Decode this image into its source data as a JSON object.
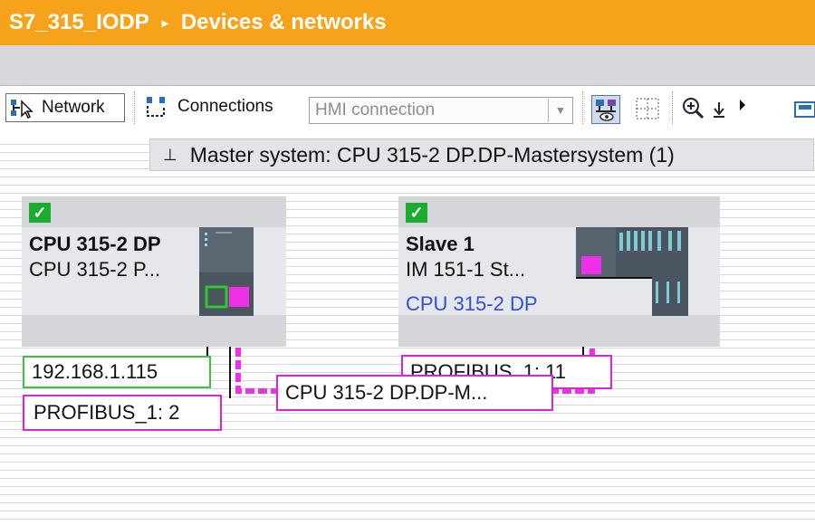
{
  "title_bar": {
    "project": "S7_315_IODP",
    "separator": "▸",
    "view": "Devices & networks"
  },
  "toolbar": {
    "network_label": "Network",
    "connections_label": "Connections",
    "connection_type_value": "HMI connection",
    "icons": [
      "network-tool-icon",
      "connections-tool-icon",
      "network-overview-icon",
      "grid-icon",
      "zoom-in-icon",
      "download-icon",
      "expand-arrow-icon",
      "save-icon"
    ]
  },
  "master_system": {
    "pin": "⊥",
    "label": "Master system: CPU 315-2 DP.DP-Mastersystem (1)"
  },
  "devices": [
    {
      "name": "CPU 315-2 DP",
      "type": "CPU 315-2 P...",
      "status": "ok"
    },
    {
      "name": "Slave  1",
      "type": "IM 151-1 St...",
      "master": "CPU 315-2 DP",
      "status": "ok"
    }
  ],
  "labels": {
    "ip_address": "192.168.1.115",
    "cpu_profibus": "PROFIBUS_1:  2",
    "slave_profibus": "PROFIBUS_1:  11",
    "subnet": "CPU  315-2  DP.DP-M..."
  },
  "colors": {
    "title_bar": "#f7a21b",
    "profibus": "#f030e8",
    "ethernet": "#2ec82e",
    "status_ok": "#1bab2f",
    "link_text": "#3050d8"
  }
}
